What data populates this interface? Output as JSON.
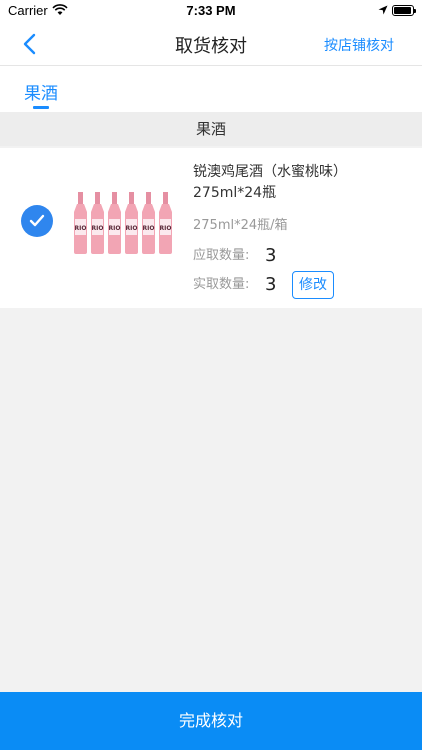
{
  "status_bar": {
    "carrier": "Carrier",
    "time": "7:33 PM"
  },
  "nav": {
    "title": "取货核对",
    "action_label": "按店铺核对"
  },
  "tabs": [
    {
      "label": "果酒",
      "active": true
    }
  ],
  "section": {
    "title": "果酒"
  },
  "product": {
    "name": "锐澳鸡尾酒（水蜜桃味）275ml*24瓶",
    "spec": "275ml*24瓶/箱",
    "expected_label": "应取数量:",
    "expected_value": "3",
    "actual_label": "实取数量:",
    "actual_value": "3",
    "edit_label": "修改",
    "checked": true,
    "image_label": "RIO"
  },
  "footer": {
    "button_label": "完成核对"
  },
  "colors": {
    "accent": "#1a8cff",
    "check": "#2f86ee",
    "footer": "#0a8cf5",
    "bottle": "#f2a5b4"
  }
}
